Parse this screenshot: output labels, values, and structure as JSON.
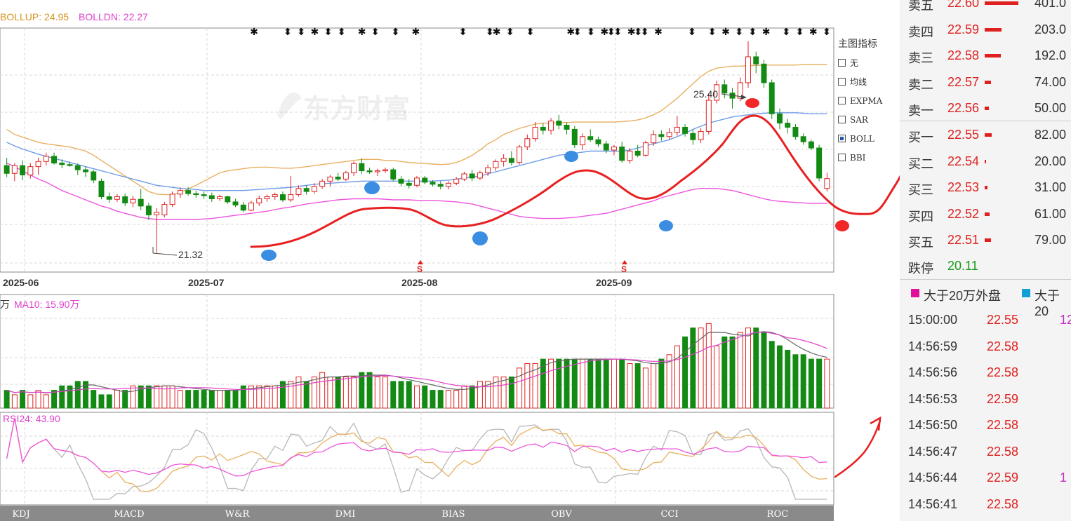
{
  "main_chart": {
    "boll_up_label": "BOLLUP: 24.95",
    "boll_dn_label": "BOLLDN: 22.27",
    "watermark": "东方财富",
    "high_annotation": "25.40",
    "low_annotation": "21.32",
    "signal_marker": "S",
    "x_labels": [
      "2025-06",
      "2025-07",
      "2025-08",
      "2025-09"
    ]
  },
  "indicator_menu": {
    "title": "主图指标",
    "options": [
      {
        "label": "无",
        "checked": false
      },
      {
        "label": "均线",
        "checked": false
      },
      {
        "label": "EXPMA",
        "checked": false
      },
      {
        "label": "SAR",
        "checked": false
      },
      {
        "label": "BOLL",
        "checked": true
      },
      {
        "label": "BBI",
        "checked": false
      }
    ]
  },
  "volume_panel": {
    "ma5_label": "万",
    "ma10_label": "MA10: 15.90万"
  },
  "rsi_panel": {
    "rsi_label": "RSI24: 43.90"
  },
  "bottom_tabs": [
    "KDJ",
    "MACD",
    "W&R",
    "DMI",
    "BIAS",
    "OBV",
    "CCI",
    "ROC"
  ],
  "order_book": {
    "asks": [
      {
        "label": "卖五",
        "price": "22.60",
        "volume": "401.0",
        "bar_frac": 1.0
      },
      {
        "label": "卖四",
        "price": "22.59",
        "volume": "203.0",
        "bar_frac": 0.5
      },
      {
        "label": "卖三",
        "price": "22.58",
        "volume": "192.0",
        "bar_frac": 0.48
      },
      {
        "label": "卖二",
        "price": "22.57",
        "volume": "74.00",
        "bar_frac": 0.18
      },
      {
        "label": "卖一",
        "price": "22.56",
        "volume": "50.00",
        "bar_frac": 0.12
      }
    ],
    "bids": [
      {
        "label": "买一",
        "price": "22.55",
        "volume": "82.00",
        "bar_frac": 0.2
      },
      {
        "label": "买二",
        "price": "22.54",
        "volume": "20.00",
        "bar_frac": 0.05
      },
      {
        "label": "买三",
        "price": "22.53",
        "volume": "31.00",
        "bar_frac": 0.08
      },
      {
        "label": "买四",
        "price": "22.52",
        "volume": "61.00",
        "bar_frac": 0.15
      },
      {
        "label": "买五",
        "price": "22.51",
        "volume": "79.00",
        "bar_frac": 0.19
      }
    ],
    "limit_down": {
      "label": "跌停",
      "price": "20.11"
    }
  },
  "trade_legend": {
    "item1": "大于20万外盘",
    "item2": "大于20",
    "color1": "#e0109a",
    "color2": "#10a0d8"
  },
  "ticks": [
    {
      "time": "15:00:00",
      "price": "22.55",
      "vol": "12"
    },
    {
      "time": "14:56:59",
      "price": "22.58",
      "vol": ""
    },
    {
      "time": "14:56:56",
      "price": "22.58",
      "vol": ""
    },
    {
      "time": "14:56:53",
      "price": "22.59",
      "vol": ""
    },
    {
      "time": "14:56:50",
      "price": "22.58",
      "vol": ""
    },
    {
      "time": "14:56:47",
      "price": "22.58",
      "vol": ""
    },
    {
      "time": "14:56:44",
      "price": "22.59",
      "vol": "1"
    },
    {
      "time": "14:56:41",
      "price": "22.58",
      "vol": ""
    }
  ],
  "colors": {
    "up": "#e02020",
    "down": "#138a13",
    "boll_upper": "#e8b060",
    "boll_mid": "#6f9ce8",
    "boll_lower": "#ee55dd",
    "annotation_red": "#e02020",
    "annotation_blue": "#3a8de0"
  },
  "chart_data": {
    "type": "candlestick",
    "title": "",
    "x_labels": [
      "2025-06",
      "2025-07",
      "2025-08",
      "2025-09"
    ],
    "ylim": [
      21.0,
      25.6
    ],
    "candles": [
      {
        "o": 23.0,
        "h": 23.15,
        "l": 22.78,
        "c": 22.85
      },
      {
        "o": 22.85,
        "h": 23.05,
        "l": 22.7,
        "c": 23.0
      },
      {
        "o": 23.0,
        "h": 23.1,
        "l": 22.72,
        "c": 22.82
      },
      {
        "o": 22.82,
        "h": 23.05,
        "l": 22.75,
        "c": 22.98
      },
      {
        "o": 22.98,
        "h": 23.15,
        "l": 22.82,
        "c": 23.08
      },
      {
        "o": 23.08,
        "h": 23.25,
        "l": 23.0,
        "c": 23.18
      },
      {
        "o": 23.18,
        "h": 23.25,
        "l": 23.02,
        "c": 23.05
      },
      {
        "o": 23.05,
        "h": 23.12,
        "l": 22.95,
        "c": 23.02
      },
      {
        "o": 23.02,
        "h": 23.08,
        "l": 22.98,
        "c": 23.0
      },
      {
        "o": 23.0,
        "h": 23.04,
        "l": 22.82,
        "c": 22.92
      },
      {
        "o": 22.92,
        "h": 22.98,
        "l": 22.78,
        "c": 22.88
      },
      {
        "o": 22.88,
        "h": 22.92,
        "l": 22.66,
        "c": 22.72
      },
      {
        "o": 22.7,
        "h": 22.75,
        "l": 22.35,
        "c": 22.4
      },
      {
        "o": 22.4,
        "h": 22.48,
        "l": 22.28,
        "c": 22.35
      },
      {
        "o": 22.35,
        "h": 22.45,
        "l": 22.3,
        "c": 22.4
      },
      {
        "o": 22.4,
        "h": 22.46,
        "l": 22.22,
        "c": 22.28
      },
      {
        "o": 22.28,
        "h": 22.42,
        "l": 22.2,
        "c": 22.35
      },
      {
        "o": 22.35,
        "h": 22.55,
        "l": 22.14,
        "c": 22.22
      },
      {
        "o": 22.22,
        "h": 22.28,
        "l": 21.95,
        "c": 22.05
      },
      {
        "o": 22.05,
        "h": 22.18,
        "l": 21.32,
        "c": 22.1
      },
      {
        "o": 22.05,
        "h": 22.3,
        "l": 22.0,
        "c": 22.25
      },
      {
        "o": 22.25,
        "h": 22.5,
        "l": 22.2,
        "c": 22.45
      },
      {
        "o": 22.45,
        "h": 22.58,
        "l": 22.38,
        "c": 22.52
      },
      {
        "o": 22.52,
        "h": 22.58,
        "l": 22.42,
        "c": 22.46
      },
      {
        "o": 22.46,
        "h": 22.52,
        "l": 22.38,
        "c": 22.44
      },
      {
        "o": 22.44,
        "h": 22.5,
        "l": 22.36,
        "c": 22.42
      },
      {
        "o": 22.42,
        "h": 22.48,
        "l": 22.3,
        "c": 22.36
      },
      {
        "o": 22.36,
        "h": 22.44,
        "l": 22.32,
        "c": 22.4
      },
      {
        "o": 22.4,
        "h": 22.42,
        "l": 22.26,
        "c": 22.3
      },
      {
        "o": 22.3,
        "h": 22.36,
        "l": 22.2,
        "c": 22.24
      },
      {
        "o": 22.24,
        "h": 22.3,
        "l": 22.1,
        "c": 22.14
      },
      {
        "o": 22.14,
        "h": 22.32,
        "l": 22.12,
        "c": 22.28
      },
      {
        "o": 22.28,
        "h": 22.42,
        "l": 22.22,
        "c": 22.36
      },
      {
        "o": 22.36,
        "h": 22.44,
        "l": 22.3,
        "c": 22.4
      },
      {
        "o": 22.4,
        "h": 22.48,
        "l": 22.34,
        "c": 22.44
      },
      {
        "o": 22.44,
        "h": 22.5,
        "l": 22.3,
        "c": 22.34
      },
      {
        "o": 22.34,
        "h": 22.8,
        "l": 22.3,
        "c": 22.44
      },
      {
        "o": 22.44,
        "h": 22.62,
        "l": 22.4,
        "c": 22.56
      },
      {
        "o": 22.56,
        "h": 22.62,
        "l": 22.44,
        "c": 22.5
      },
      {
        "o": 22.5,
        "h": 22.66,
        "l": 22.46,
        "c": 22.6
      },
      {
        "o": 22.6,
        "h": 22.74,
        "l": 22.55,
        "c": 22.7
      },
      {
        "o": 22.7,
        "h": 22.82,
        "l": 22.6,
        "c": 22.78
      },
      {
        "o": 22.78,
        "h": 22.86,
        "l": 22.7,
        "c": 22.74
      },
      {
        "o": 22.74,
        "h": 22.9,
        "l": 22.7,
        "c": 22.86
      },
      {
        "o": 22.86,
        "h": 23.08,
        "l": 22.8,
        "c": 23.04
      },
      {
        "o": 23.04,
        "h": 23.14,
        "l": 22.84,
        "c": 22.9
      },
      {
        "o": 22.9,
        "h": 22.96,
        "l": 22.84,
        "c": 22.88
      },
      {
        "o": 22.88,
        "h": 22.94,
        "l": 22.8,
        "c": 22.9
      },
      {
        "o": 22.9,
        "h": 22.96,
        "l": 22.86,
        "c": 22.92
      },
      {
        "o": 22.92,
        "h": 22.96,
        "l": 22.7,
        "c": 22.74
      },
      {
        "o": 22.74,
        "h": 22.8,
        "l": 22.6,
        "c": 22.66
      },
      {
        "o": 22.66,
        "h": 22.74,
        "l": 22.56,
        "c": 22.62
      },
      {
        "o": 22.62,
        "h": 22.8,
        "l": 22.58,
        "c": 22.76
      },
      {
        "o": 22.76,
        "h": 22.8,
        "l": 22.64,
        "c": 22.68
      },
      {
        "o": 22.68,
        "h": 22.72,
        "l": 22.6,
        "c": 22.64
      },
      {
        "o": 22.64,
        "h": 22.7,
        "l": 22.54,
        "c": 22.6
      },
      {
        "o": 22.6,
        "h": 22.7,
        "l": 22.54,
        "c": 22.66
      },
      {
        "o": 22.66,
        "h": 22.78,
        "l": 22.62,
        "c": 22.74
      },
      {
        "o": 22.74,
        "h": 22.88,
        "l": 22.7,
        "c": 22.84
      },
      {
        "o": 22.84,
        "h": 22.92,
        "l": 22.7,
        "c": 22.76
      },
      {
        "o": 22.76,
        "h": 22.9,
        "l": 22.72,
        "c": 22.86
      },
      {
        "o": 22.86,
        "h": 23.02,
        "l": 22.8,
        "c": 22.96
      },
      {
        "o": 22.96,
        "h": 23.12,
        "l": 22.9,
        "c": 23.08
      },
      {
        "o": 23.08,
        "h": 23.22,
        "l": 22.98,
        "c": 23.14
      },
      {
        "o": 23.14,
        "h": 23.28,
        "l": 23.0,
        "c": 23.06
      },
      {
        "o": 23.06,
        "h": 23.4,
        "l": 23.02,
        "c": 23.36
      },
      {
        "o": 23.36,
        "h": 23.6,
        "l": 23.3,
        "c": 23.52
      },
      {
        "o": 23.52,
        "h": 23.84,
        "l": 23.46,
        "c": 23.74
      },
      {
        "o": 23.74,
        "h": 23.82,
        "l": 23.6,
        "c": 23.68
      },
      {
        "o": 23.68,
        "h": 23.92,
        "l": 23.6,
        "c": 23.86
      },
      {
        "o": 23.86,
        "h": 23.98,
        "l": 23.7,
        "c": 23.78
      },
      {
        "o": 23.78,
        "h": 23.84,
        "l": 23.6,
        "c": 23.7
      },
      {
        "o": 23.7,
        "h": 23.76,
        "l": 23.34,
        "c": 23.4
      },
      {
        "o": 23.4,
        "h": 23.62,
        "l": 23.3,
        "c": 23.56
      },
      {
        "o": 23.56,
        "h": 23.7,
        "l": 23.46,
        "c": 23.5
      },
      {
        "o": 23.5,
        "h": 23.56,
        "l": 23.36,
        "c": 23.42
      },
      {
        "o": 23.42,
        "h": 23.48,
        "l": 23.24,
        "c": 23.3
      },
      {
        "o": 23.3,
        "h": 23.4,
        "l": 23.2,
        "c": 23.36
      },
      {
        "o": 23.36,
        "h": 23.46,
        "l": 23.06,
        "c": 23.1
      },
      {
        "o": 23.1,
        "h": 23.34,
        "l": 23.04,
        "c": 23.28
      },
      {
        "o": 23.28,
        "h": 23.4,
        "l": 23.16,
        "c": 23.2
      },
      {
        "o": 23.2,
        "h": 23.48,
        "l": 23.18,
        "c": 23.44
      },
      {
        "o": 23.44,
        "h": 23.68,
        "l": 23.38,
        "c": 23.6
      },
      {
        "o": 23.6,
        "h": 23.68,
        "l": 23.48,
        "c": 23.56
      },
      {
        "o": 23.56,
        "h": 23.72,
        "l": 23.5,
        "c": 23.64
      },
      {
        "o": 23.64,
        "h": 23.96,
        "l": 23.58,
        "c": 23.74
      },
      {
        "o": 23.74,
        "h": 23.8,
        "l": 23.56,
        "c": 23.62
      },
      {
        "o": 23.62,
        "h": 23.7,
        "l": 23.4,
        "c": 23.5
      },
      {
        "o": 23.5,
        "h": 23.72,
        "l": 23.44,
        "c": 23.66
      },
      {
        "o": 23.66,
        "h": 24.4,
        "l": 23.6,
        "c": 24.26
      },
      {
        "o": 24.26,
        "h": 24.64,
        "l": 24.2,
        "c": 24.56
      },
      {
        "o": 24.56,
        "h": 24.66,
        "l": 24.3,
        "c": 24.4
      },
      {
        "o": 24.4,
        "h": 24.5,
        "l": 24.1,
        "c": 24.3
      },
      {
        "o": 24.3,
        "h": 24.7,
        "l": 24.24,
        "c": 24.6
      },
      {
        "o": 24.6,
        "h": 25.4,
        "l": 24.5,
        "c": 25.1
      },
      {
        "o": 25.1,
        "h": 25.2,
        "l": 24.78,
        "c": 24.96
      },
      {
        "o": 24.96,
        "h": 25.04,
        "l": 24.5,
        "c": 24.6
      },
      {
        "o": 24.6,
        "h": 24.66,
        "l": 23.9,
        "c": 24.0
      },
      {
        "o": 24.0,
        "h": 24.1,
        "l": 23.7,
        "c": 23.82
      },
      {
        "o": 23.82,
        "h": 23.9,
        "l": 23.62,
        "c": 23.74
      },
      {
        "o": 23.74,
        "h": 23.8,
        "l": 23.5,
        "c": 23.56
      },
      {
        "o": 23.56,
        "h": 23.62,
        "l": 23.4,
        "c": 23.46
      },
      {
        "o": 23.46,
        "h": 23.5,
        "l": 23.3,
        "c": 23.34
      },
      {
        "o": 23.34,
        "h": 23.4,
        "l": 22.7,
        "c": 22.76
      },
      {
        "o": 22.56,
        "h": 22.86,
        "l": 22.5,
        "c": 22.75
      }
    ],
    "boll_upper": [
      23.7,
      23.6,
      23.55,
      23.5,
      23.45,
      23.42,
      23.4,
      23.38,
      23.36,
      23.32,
      23.28,
      23.2,
      23.1,
      23.0,
      22.9,
      22.8,
      22.7,
      22.6,
      22.5,
      22.45,
      22.44,
      22.44,
      22.48,
      22.55,
      22.62,
      22.7,
      22.78,
      22.86,
      22.9,
      22.92,
      22.94,
      22.96,
      22.97,
      22.97,
      22.96,
      22.95,
      22.95,
      22.96,
      22.98,
      23.0,
      23.02,
      23.04,
      23.06,
      23.08,
      23.1,
      23.12,
      23.12,
      23.12,
      23.1,
      23.1,
      23.08,
      23.06,
      23.05,
      23.04,
      23.03,
      23.02,
      23.03,
      23.06,
      23.12,
      23.2,
      23.3,
      23.42,
      23.5,
      23.6,
      23.66,
      23.72,
      23.76,
      23.8,
      23.82,
      23.82,
      23.83,
      23.83,
      23.84,
      23.84,
      23.84,
      23.84,
      23.84,
      23.84,
      23.85,
      23.86,
      23.88,
      23.92,
      23.98,
      24.06,
      24.18,
      24.3,
      24.44,
      24.58,
      24.72,
      24.82,
      24.88,
      24.9,
      24.92,
      24.92,
      24.93,
      24.93,
      24.94,
      24.94,
      24.94,
      24.94,
      24.94,
      24.95,
      24.95,
      24.95,
      24.95
    ],
    "boll_mid": [
      23.45,
      23.38,
      23.32,
      23.27,
      23.22,
      23.18,
      23.14,
      23.1,
      23.06,
      23.02,
      22.98,
      22.94,
      22.9,
      22.86,
      22.82,
      22.78,
      22.74,
      22.7,
      22.66,
      22.62,
      22.6,
      22.58,
      22.56,
      22.55,
      22.54,
      22.52,
      22.52,
      22.52,
      22.52,
      22.52,
      22.52,
      22.53,
      22.54,
      22.55,
      22.56,
      22.57,
      22.58,
      22.6,
      22.62,
      22.64,
      22.65,
      22.66,
      22.67,
      22.68,
      22.69,
      22.7,
      22.7,
      22.7,
      22.7,
      22.7,
      22.7,
      22.7,
      22.7,
      22.7,
      22.7,
      22.71,
      22.72,
      22.74,
      22.76,
      22.78,
      22.8,
      22.84,
      22.88,
      22.92,
      22.96,
      23.0,
      23.04,
      23.08,
      23.12,
      23.16,
      23.2,
      23.22,
      23.24,
      23.26,
      23.28,
      23.28,
      23.28,
      23.28,
      23.28,
      23.3,
      23.34,
      23.38,
      23.42,
      23.46,
      23.5,
      23.56,
      23.62,
      23.7,
      23.76,
      23.82,
      23.86,
      23.9,
      23.94,
      23.96,
      23.98,
      24.0,
      24.01,
      24.02,
      24.02,
      24.02,
      24.02,
      24.01,
      24.0,
      24.0,
      24.0
    ],
    "boll_lower": [
      23.05,
      22.98,
      22.9,
      22.82,
      22.74,
      22.68,
      22.6,
      22.52,
      22.46,
      22.4,
      22.34,
      22.28,
      22.22,
      22.18,
      22.12,
      22.08,
      22.04,
      22.0,
      21.98,
      21.96,
      21.96,
      21.96,
      21.96,
      21.96,
      21.96,
      21.97,
      21.98,
      22.0,
      22.02,
      22.04,
      22.06,
      22.08,
      22.1,
      22.12,
      22.15,
      22.18,
      22.2,
      22.23,
      22.26,
      22.28,
      22.3,
      22.32,
      22.34,
      22.35,
      22.36,
      22.36,
      22.36,
      22.36,
      22.35,
      22.34,
      22.34,
      22.34,
      22.33,
      22.33,
      22.33,
      22.32,
      22.31,
      22.3,
      22.28,
      22.26,
      22.22,
      22.18,
      22.14,
      22.1,
      22.06,
      22.02,
      22.0,
      21.99,
      21.98,
      21.98,
      21.98,
      21.99,
      22.0,
      22.02,
      22.04,
      22.06,
      22.08,
      22.12,
      22.16,
      22.2,
      22.24,
      22.28,
      22.32,
      22.38,
      22.42,
      22.46,
      22.5,
      22.54,
      22.56,
      22.56,
      22.56,
      22.54,
      22.52,
      22.48,
      22.44,
      22.4,
      22.36,
      22.33,
      22.31,
      22.3,
      22.29,
      22.28,
      22.27,
      22.27,
      22.27
    ],
    "volume": [
      4,
      3,
      4,
      3,
      4,
      3,
      4,
      5,
      5,
      6,
      6,
      4,
      3,
      3,
      4,
      4,
      5,
      5,
      5,
      5,
      5,
      5,
      4,
      4,
      4,
      4,
      4,
      4,
      4,
      4,
      5,
      5,
      5,
      5,
      5,
      6,
      6,
      7,
      6,
      7,
      8,
      7,
      7,
      7,
      7,
      8,
      8,
      7,
      7,
      6,
      6,
      6,
      5,
      5,
      4,
      4,
      4,
      4,
      5,
      5,
      6,
      6,
      7,
      7,
      7,
      9,
      10,
      10,
      11,
      11,
      11,
      11,
      11,
      11,
      11,
      11,
      11,
      11,
      11,
      10,
      10,
      9,
      10,
      11,
      12,
      14,
      16,
      18,
      18,
      19,
      14,
      16,
      16,
      17,
      18,
      18,
      17,
      15,
      14,
      13,
      12,
      12,
      11,
      11,
      11
    ],
    "ma10_volume": [
      15.9
    ],
    "rsi24": [
      43.9
    ]
  }
}
